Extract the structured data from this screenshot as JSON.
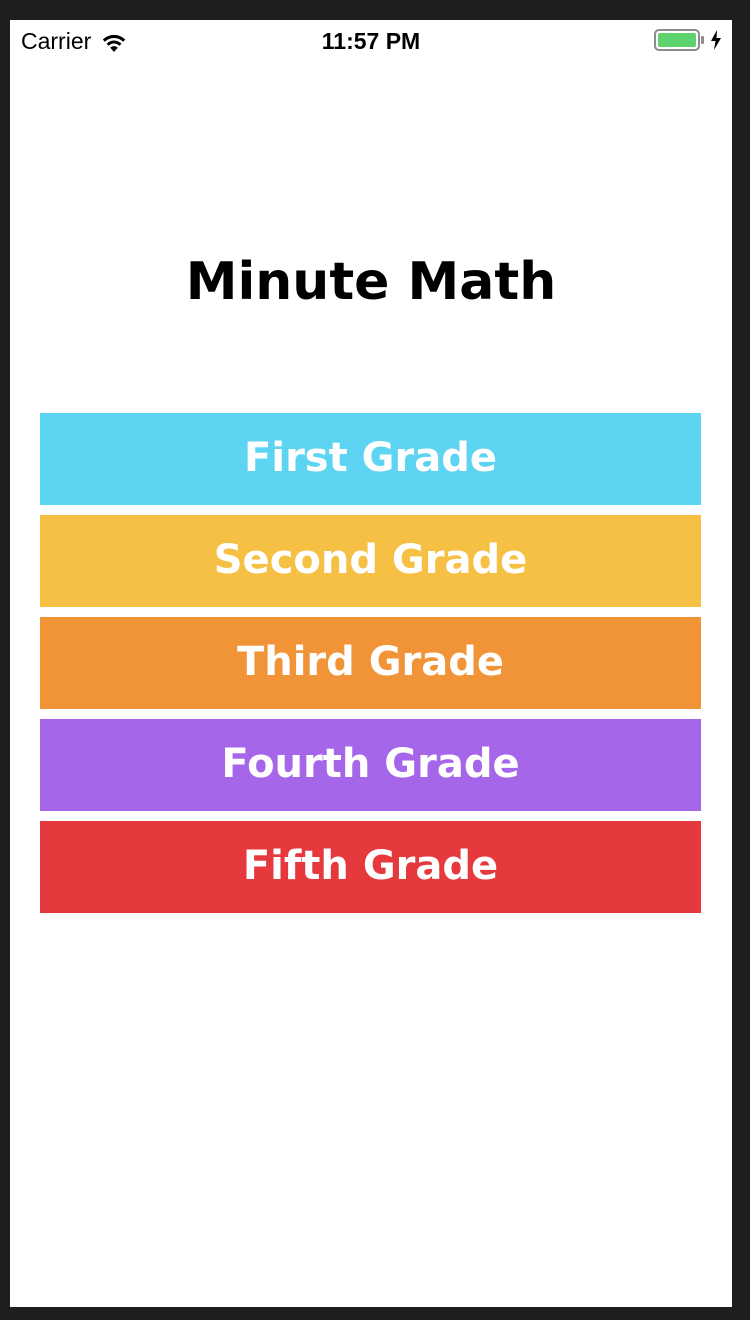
{
  "status_bar": {
    "carrier": "Carrier",
    "time": "11:57 PM",
    "wifi_icon": "wifi-icon",
    "battery_icon": "battery-icon",
    "charging_icon": "bolt-icon",
    "battery_color": "#5dd36e"
  },
  "app": {
    "title": "Minute Math"
  },
  "grades": [
    {
      "label": "First Grade",
      "color": "#5dd4f2"
    },
    {
      "label": "Second Grade",
      "color": "#f6c044"
    },
    {
      "label": "Third Grade",
      "color": "#f19337"
    },
    {
      "label": "Fourth Grade",
      "color": "#a566ea"
    },
    {
      "label": "Fifth Grade",
      "color": "#e6393d"
    }
  ]
}
